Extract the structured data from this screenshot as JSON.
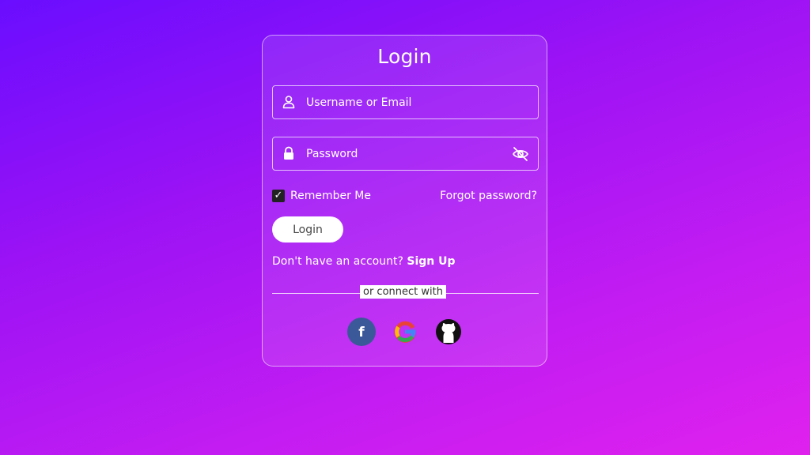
{
  "form": {
    "title": "Login",
    "username": {
      "placeholder": "Username or Email",
      "icon": "user-icon"
    },
    "password": {
      "placeholder": "Password",
      "icon": "lock-icon",
      "toggle_icon": "eye-off-icon"
    },
    "remember": {
      "label": "Remember Me",
      "checked": true,
      "check_glyph": "✓"
    },
    "forgot_label": "Forgot password?",
    "login_button": "Login",
    "signup_prompt": "Don't have an account?",
    "signup_link": "Sign Up",
    "divider_text": "or connect with",
    "social": [
      {
        "name": "facebook",
        "glyph": "f",
        "icon": "facebook-icon",
        "color": "#3b5998"
      },
      {
        "name": "google",
        "icon": "google-icon"
      },
      {
        "name": "github",
        "icon": "github-icon"
      }
    ]
  },
  "colors": {
    "bg_start": "#6a0dff",
    "bg_end": "#e021ee",
    "button_bg": "#ffffff",
    "button_text": "#444444"
  }
}
